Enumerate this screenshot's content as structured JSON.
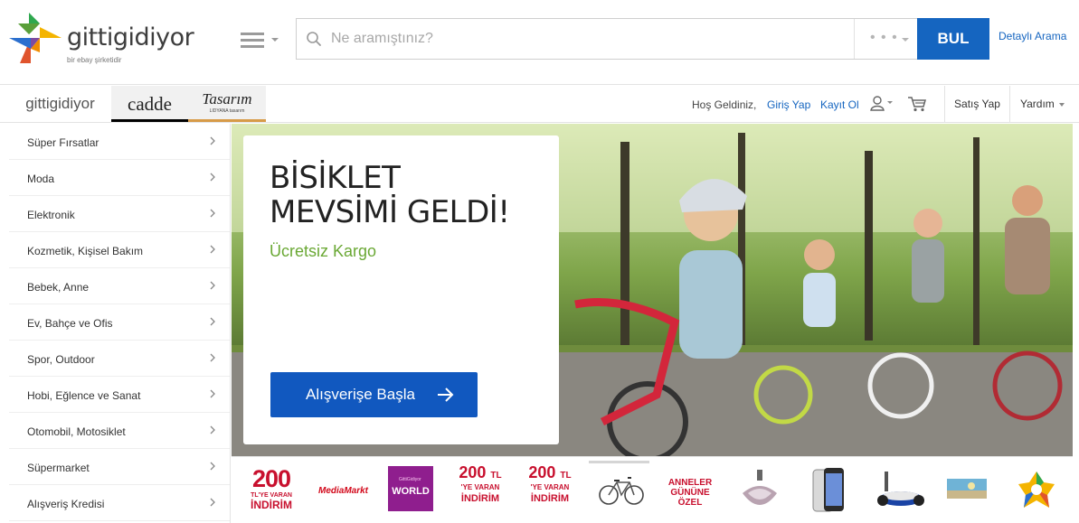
{
  "header": {
    "logo_text": "gittigidiyor",
    "logo_tagline": "bir ebay şirketidir",
    "search_placeholder": "Ne aramıştınız?",
    "search_category_dots": "• • •",
    "search_button": "BUL",
    "advanced_search": "Detaylı Arama"
  },
  "nav": {
    "tabs": [
      {
        "label": "gittigidiyor"
      },
      {
        "label": "cadde"
      },
      {
        "label": "Tasarım",
        "sub": "LIDYANA tasarım"
      }
    ],
    "welcome": "Hoş Geldiniz,",
    "login": "Giriş Yap",
    "register": "Kayıt Ol",
    "sell": "Satış Yap",
    "help": "Yardım"
  },
  "sidebar": {
    "items": [
      {
        "label": "Süper Fırsatlar"
      },
      {
        "label": "Moda"
      },
      {
        "label": "Elektronik"
      },
      {
        "label": "Kozmetik, Kişisel Bakım"
      },
      {
        "label": "Bebek, Anne"
      },
      {
        "label": "Ev, Bahçe ve Ofis"
      },
      {
        "label": "Spor, Outdoor"
      },
      {
        "label": "Hobi, Eğlence ve Sanat"
      },
      {
        "label": "Otomobil, Motosiklet"
      },
      {
        "label": "Süpermarket"
      },
      {
        "label": "Alışveriş Kredisi"
      }
    ]
  },
  "hero": {
    "title_line1": "BİSİKLET",
    "title_line2": "MEVSİMİ GELDİ!",
    "subtitle": "Ücretsiz Kargo",
    "cta": "Alışverişe Başla"
  },
  "strip": {
    "items": [
      {
        "n": "200",
        "s": "TL'YE VARAN",
        "i": "İNDİRİM"
      },
      {
        "brand": "MediaMarkt"
      },
      {
        "top": "GittiGidiyor",
        "label": "WORLD"
      },
      {
        "n": "200",
        "unit": "TL",
        "s": "'YE VARAN",
        "i": "İNDİRİM"
      },
      {
        "n": "200",
        "unit": "TL",
        "s": "'YE VARAN",
        "i": "İNDİRİM"
      },
      {
        "icon": "bicycle-icon"
      },
      {
        "line1": "ANNELER",
        "line2": "GÜNÜNE",
        "line3": "ÖZEL"
      },
      {
        "icon": "perfume-icon"
      },
      {
        "icon": "smartphone-icon"
      },
      {
        "icon": "hoverboard-icon"
      },
      {
        "icon": "landscape-print-icon"
      },
      {
        "icon": "colorful-star-icon"
      }
    ]
  },
  "colors": {
    "brand_blue": "#1565c0",
    "cta_blue": "#1158bf",
    "green": "#6aa834",
    "red": "#c8102e"
  }
}
